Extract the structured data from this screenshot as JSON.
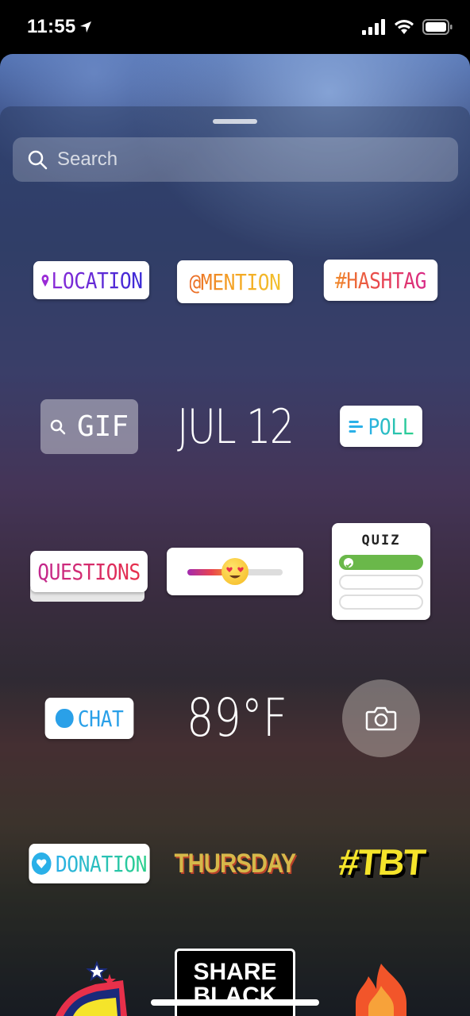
{
  "status_bar": {
    "time": "11:55"
  },
  "search": {
    "placeholder": "Search"
  },
  "stickers": {
    "location": "LOCATION",
    "mention": "@MENTION",
    "hashtag": "#HASHTAG",
    "gif": "GIF",
    "date": "JUL 12",
    "poll": "POLL",
    "questions": "QUESTIONS",
    "slider": {
      "level": 0.5,
      "emoji": "heart-eyes-emoji"
    },
    "quiz": {
      "title": "QUIZ",
      "options": 3,
      "correct_option": 1
    },
    "chat": "CHAT",
    "temperature": "89°F",
    "camera": "camera-icon",
    "donation": "DONATION",
    "thursday": "THURSDAY",
    "tbt": "#TBT",
    "share_black": [
      "SHARE",
      "BLACK"
    ]
  },
  "colors": {
    "poll_accent": "#2ab0e8",
    "quiz_correct": "#6ab84a",
    "chat_accent": "#2aa0e8",
    "donation_accent": "#2ab0e8",
    "tbt_yellow": "#f5e42a"
  }
}
